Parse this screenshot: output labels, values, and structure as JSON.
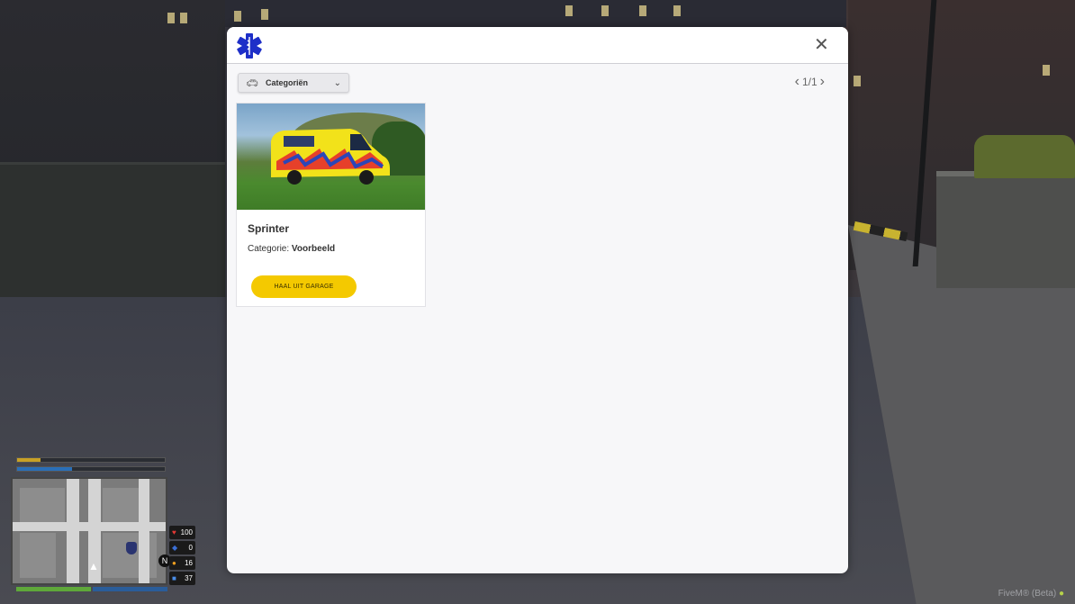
{
  "modal": {
    "logo_icon": "star-of-life-icon",
    "close_icon": "close-icon",
    "close_glyph": "✕"
  },
  "toolbar": {
    "category_label": "Categoriën",
    "category_icon": "car-icon",
    "chevron_icon": "chevron-down-icon"
  },
  "pagination": {
    "page_text": "1/1",
    "prev_icon": "chevron-left-icon",
    "next_icon": "chevron-right-icon"
  },
  "vehicles": [
    {
      "name": "Sprinter",
      "category_prefix": "Categorie: ",
      "category_value": "Voorbeeld",
      "button_label": "HAAL UIT GARAGE"
    }
  ],
  "hud": {
    "health": "100",
    "armor": "0",
    "hunger": "16",
    "thirst": "37",
    "compass": "N",
    "bars": [
      {
        "name": "stamina",
        "fill": 0.16,
        "color": "#c8a126"
      },
      {
        "name": "oxygen",
        "fill": 0.37,
        "color": "#2a6fb8"
      }
    ],
    "map_bottom": [
      {
        "fill": 0.5,
        "color": "#5fa83a"
      },
      {
        "fill": 0.5,
        "color": "#2a5d9a"
      }
    ]
  },
  "watermark": "FiveM® (Beta)",
  "colors": {
    "accent": "#f4c900",
    "logo_blue": "#1e2fc8"
  }
}
